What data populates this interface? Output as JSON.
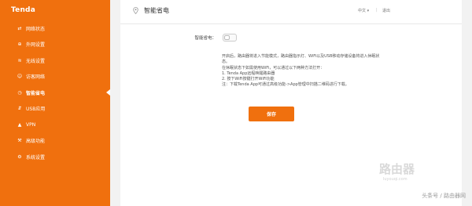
{
  "sidebar": {
    "logo": "Tenda",
    "items": [
      {
        "icon": "⇄",
        "label": "网络状态"
      },
      {
        "icon": "⊕",
        "label": "外网设置"
      },
      {
        "icon": "≋",
        "label": "无线设置"
      },
      {
        "icon": "☺",
        "label": "访客网络"
      },
      {
        "icon": "◷",
        "label": "智能省电"
      },
      {
        "icon": "⇵",
        "label": "USB应用"
      },
      {
        "icon": "▲",
        "label": "VPN"
      },
      {
        "icon": "⚒",
        "label": "高级功能"
      },
      {
        "icon": "⚙",
        "label": "系统设置"
      }
    ],
    "active_index": 4
  },
  "header": {
    "title": "智能省电",
    "language": "中文 ▾",
    "separator": "|",
    "logout": "退出"
  },
  "form": {
    "label": "智能省电：",
    "toggle_on": false
  },
  "description": [
    "开启后，路由器将进入节能模式，路由器指示灯、WiFi以及USB移动存储设备将进入休眠状",
    "态。",
    "在休眠状态下如需使用WiFi，可以通过以下两种方法打开：",
    "1. Tenda App远程唤醒路由器",
    "2. 按下WiFi按键打开WiFi功能",
    "注：下载Tenda App可通过高级功能->App管理中扫描二维码进行下载。"
  ],
  "save_button": "保存",
  "watermark": {
    "big": "路由器",
    "url": "luyouqi.com",
    "source": "头条号 / 路由器网"
  },
  "colors": {
    "accent": "#f0700e"
  }
}
